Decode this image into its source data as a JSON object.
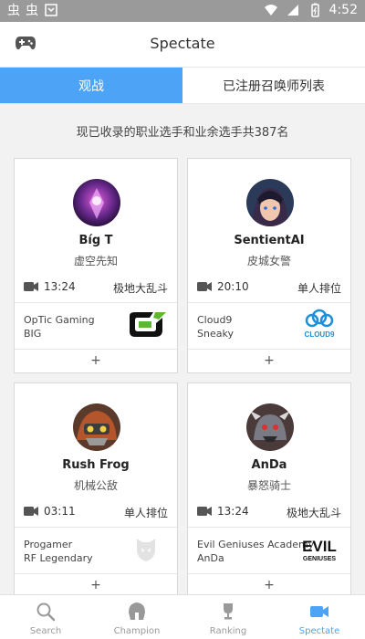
{
  "status": {
    "time": "4:52",
    "left_icons": [
      "虫",
      "虫"
    ]
  },
  "header": {
    "title": "Spectate"
  },
  "tabs": [
    {
      "label": "观战"
    },
    {
      "label": "已注册召唤师列表"
    }
  ],
  "info_text": "现已收录的职业选手和业余选手共387名",
  "cards": [
    {
      "name": "Bíg T",
      "champion": "虚空先知",
      "duration": "13:24",
      "mode": "极地大乱斗",
      "team": "OpTic Gaming",
      "player": "BIG",
      "team_logo": "optic-gaming-logo"
    },
    {
      "name": "SentientAI",
      "champion": "皮城女警",
      "duration": "20:10",
      "mode": "单人排位",
      "team": "Cloud9",
      "player": "Sneaky",
      "team_logo": "cloud9-logo",
      "logo_text": "CLOUD9"
    },
    {
      "name": "Rush Frog",
      "champion": "机械公敌",
      "duration": "03:11",
      "mode": "单人排位",
      "team": "Progamer",
      "player": "RF Legendary",
      "team_logo": "progamer-logo"
    },
    {
      "name": "AnDa",
      "champion": "暴怒骑士",
      "duration": "13:24",
      "mode": "极地大乱斗",
      "team": "Evil Geniuses Academy",
      "player": "AnDa",
      "team_logo": "evil-geniuses-logo",
      "logo_text": "EVIL",
      "logo_subtext": "GENIUSES"
    }
  ],
  "card_plus": "+",
  "nav": [
    {
      "label": "Search",
      "icon": "search-icon"
    },
    {
      "label": "Champion",
      "icon": "helmet-icon"
    },
    {
      "label": "Ranking",
      "icon": "trophy-icon"
    },
    {
      "label": "Spectate",
      "icon": "spectate-icon"
    }
  ],
  "colors": {
    "accent": "#4da3f5",
    "statusbar": "#9a9a9a",
    "background": "#f2f2f2"
  }
}
